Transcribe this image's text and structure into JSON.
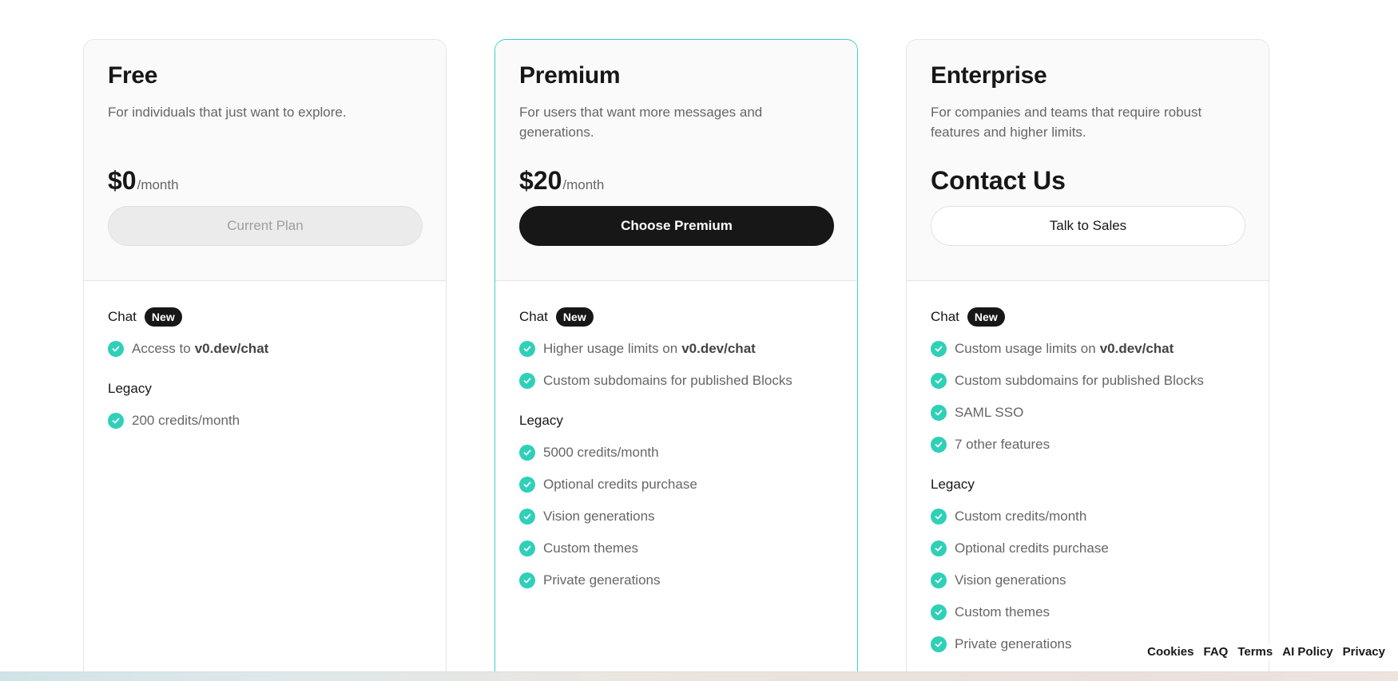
{
  "plans": [
    {
      "name": "Free",
      "description": "For individuals that just want to explore.",
      "price": "$0",
      "period": "/month",
      "cta": "Current Plan",
      "chat_section": {
        "title": "Chat",
        "badge": "New",
        "features": [
          {
            "text": "Access to",
            "bold": "v0.dev/chat"
          }
        ]
      },
      "legacy_section": {
        "title": "Legacy",
        "features": [
          {
            "text": "200 credits/month",
            "bold": ""
          }
        ]
      }
    },
    {
      "name": "Premium",
      "description": "For users that want more messages and generations.",
      "price": "$20",
      "period": "/month",
      "cta": "Choose Premium",
      "chat_section": {
        "title": "Chat",
        "badge": "New",
        "features": [
          {
            "text": "Higher usage limits on",
            "bold": "v0.dev/chat"
          },
          {
            "text": "Custom subdomains for published Blocks",
            "bold": ""
          }
        ]
      },
      "legacy_section": {
        "title": "Legacy",
        "features": [
          {
            "text": "5000 credits/month",
            "bold": ""
          },
          {
            "text": "Optional credits purchase",
            "bold": ""
          },
          {
            "text": "Vision generations",
            "bold": ""
          },
          {
            "text": "Custom themes",
            "bold": ""
          },
          {
            "text": "Private generations",
            "bold": ""
          }
        ]
      }
    },
    {
      "name": "Enterprise",
      "description": "For companies and teams that require robust features and higher limits.",
      "price": "Contact Us",
      "period": "",
      "cta": "Talk to Sales",
      "chat_section": {
        "title": "Chat",
        "badge": "New",
        "features": [
          {
            "text": "Custom usage limits on",
            "bold": "v0.dev/chat"
          },
          {
            "text": "Custom subdomains for published Blocks",
            "bold": ""
          },
          {
            "text": "SAML SSO",
            "bold": ""
          },
          {
            "text": "7 other features",
            "bold": ""
          }
        ]
      },
      "legacy_section": {
        "title": "Legacy",
        "features": [
          {
            "text": "Custom credits/month",
            "bold": ""
          },
          {
            "text": "Optional credits purchase",
            "bold": ""
          },
          {
            "text": "Vision generations",
            "bold": ""
          },
          {
            "text": "Custom themes",
            "bold": ""
          },
          {
            "text": "Private generations",
            "bold": ""
          }
        ]
      }
    }
  ],
  "footer": {
    "links": [
      "Cookies",
      "FAQ",
      "Terms",
      "AI Policy",
      "Privacy"
    ]
  },
  "colors": {
    "accent": "#2fd0b7",
    "featured_border": "#3dd3c0",
    "primary_button": "#171717"
  },
  "icons": {
    "feature_check": "check-circle-icon"
  }
}
